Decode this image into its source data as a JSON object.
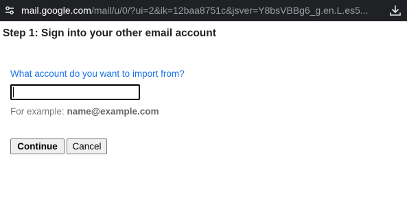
{
  "browser": {
    "url_domain": "mail.google.com",
    "url_path": "/mail/u/0/?ui=2&ik=12baa8751c&jsver=Y8bsVBBg6_g.en.L.es5...",
    "site_info_icon": "tune-icon",
    "download_icon": "download-icon"
  },
  "page": {
    "heading": "Step 1: Sign into your other email account",
    "question": "What account do you want to import from?",
    "email_value": "",
    "example_prefix": "For example: ",
    "example_value": "name@example.com",
    "continue_label": "Continue",
    "cancel_label": "Cancel"
  },
  "colors": {
    "address_bar_bg": "#202124",
    "question_text": "#1a73e8",
    "hint_text": "#777777"
  }
}
